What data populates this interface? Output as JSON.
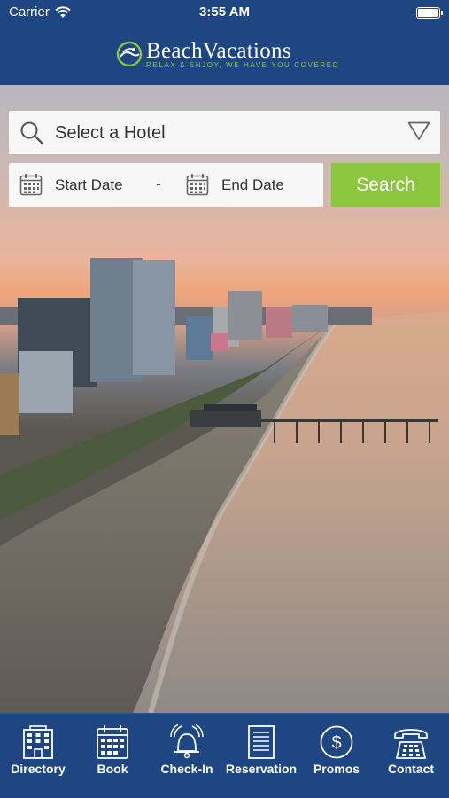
{
  "status_bar": {
    "carrier": "Carrier",
    "time": "3:55 AM"
  },
  "header": {
    "brand_name": "BeachVacations",
    "tagline": "RELAX & ENJOY, WE HAVE YOU COVERED"
  },
  "search": {
    "hotel_placeholder": "Select a Hotel",
    "start_date_label": "Start Date",
    "separator": "-",
    "end_date_label": "End Date",
    "search_label": "Search",
    "accent_color": "#8cc63f"
  },
  "tabs": [
    {
      "label": "Directory",
      "icon": "building-icon"
    },
    {
      "label": "Book",
      "icon": "calendar-icon"
    },
    {
      "label": "Check-In",
      "icon": "bell-icon"
    },
    {
      "label": "Reservation",
      "icon": "document-icon"
    },
    {
      "label": "Promos",
      "icon": "dollar-coin-icon"
    },
    {
      "label": "Contact",
      "icon": "telephone-icon"
    }
  ],
  "colors": {
    "brand_blue": "#1d4683",
    "brand_green": "#8cc63f"
  }
}
